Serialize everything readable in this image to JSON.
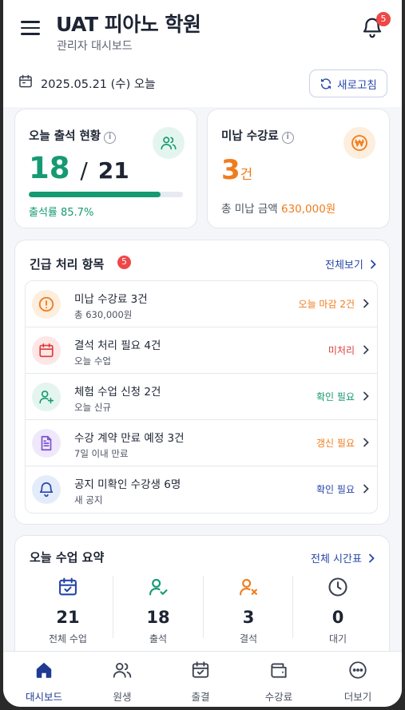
{
  "header": {
    "title": "UAT 피아노 학원",
    "subtitle": "관리자 대시보드",
    "notification_count": "5"
  },
  "date_bar": {
    "date": "2025.05.21 (수) 오늘",
    "refresh_label": "새로고침"
  },
  "attendance_card": {
    "title": "오늘 출석 현황",
    "present": "18",
    "separator": "/",
    "total": "21",
    "rate_label": "출석률 85.7%",
    "rate_fraction": 0.857
  },
  "unpaid_card": {
    "title": "미납 수강료",
    "count": "3",
    "count_unit": "건",
    "amount_label": "총 미납 금액",
    "amount": "630,000원"
  },
  "urgent": {
    "title": "긴급 처리 항목",
    "badge": "5",
    "view_all": "전체보기",
    "items": [
      {
        "title": "미납 수강료 3건",
        "sub": "총 630,000원",
        "status": "오늘 마감 2건",
        "icon": "alert-circle-icon"
      },
      {
        "title": "결석 처리 필요 4건",
        "sub": "오늘 수업",
        "status": "미처리",
        "icon": "calendar-icon"
      },
      {
        "title": "체험 수업 신청 2건",
        "sub": "오늘 신규",
        "status": "확인 필요",
        "icon": "user-plus-icon"
      },
      {
        "title": "수강 계약 만료 예정 3건",
        "sub": "7일 이내 만료",
        "status": "갱신 필요",
        "icon": "document-icon"
      },
      {
        "title": "공지 미확인 수강생 6명",
        "sub": "새 공지",
        "status": "확인 필요",
        "icon": "bell-icon"
      }
    ]
  },
  "summary": {
    "title": "오늘 수업 요약",
    "view_all": "전체 시간표",
    "stats": [
      {
        "value": "21",
        "label": "전체 수업"
      },
      {
        "value": "18",
        "label": "출석"
      },
      {
        "value": "3",
        "label": "결석"
      },
      {
        "value": "0",
        "label": "대기"
      }
    ]
  },
  "nav": {
    "items": [
      {
        "label": "대시보드"
      },
      {
        "label": "원생"
      },
      {
        "label": "출결"
      },
      {
        "label": "수강료"
      },
      {
        "label": "더보기"
      }
    ]
  },
  "colors": {
    "primary": "#1f3a93",
    "green": "#159a72",
    "orange": "#f07c1c",
    "red": "#e03a3a",
    "purple": "#7b4fd1",
    "blue": "#2746a8"
  }
}
